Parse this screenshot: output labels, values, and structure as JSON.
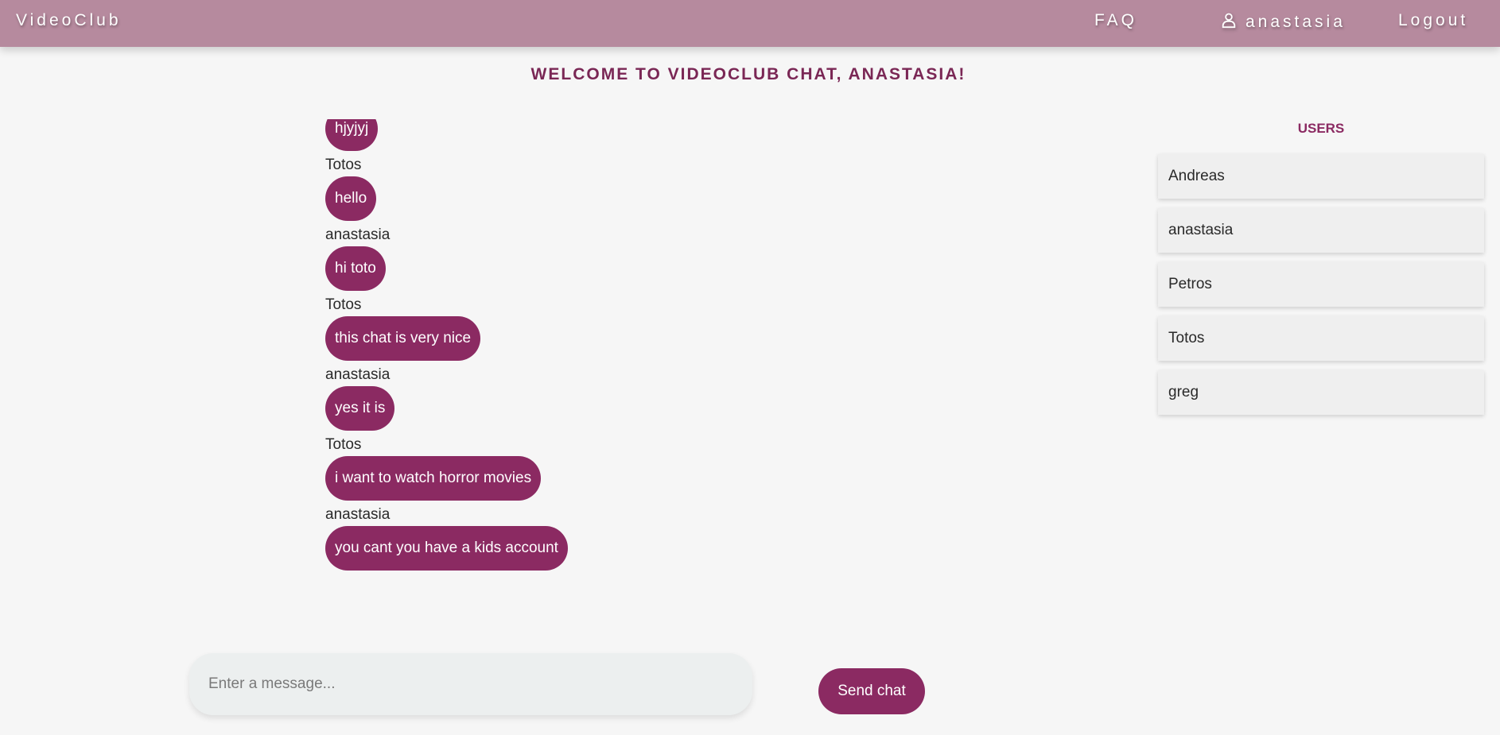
{
  "navbar": {
    "brand": "VideoClub",
    "faq_label": "FAQ",
    "user_label": "anastasia",
    "logout_label": "Logout"
  },
  "welcome": "WELCOME TO VIDEOCLUB CHAT, ANASTASIA!",
  "chat": {
    "messages": [
      {
        "sender": "",
        "text": "hjyjyj"
      },
      {
        "sender": "Totos",
        "text": "hello"
      },
      {
        "sender": "anastasia",
        "text": "hi toto"
      },
      {
        "sender": "Totos",
        "text": "this chat is very nice"
      },
      {
        "sender": "anastasia",
        "text": "yes it is"
      },
      {
        "sender": "Totos",
        "text": "i want to watch horror movies"
      },
      {
        "sender": "anastasia",
        "text": "you cant you have a kids account"
      }
    ]
  },
  "users": {
    "title": "USERS",
    "list": [
      "Andreas",
      "anastasia",
      "Petros",
      "Totos",
      "greg"
    ]
  },
  "composer": {
    "placeholder": "Enter a message...",
    "value": "",
    "send_label": "Send chat"
  },
  "colors": {
    "navbar": "#b68a9e",
    "accent": "#8b2a62",
    "title": "#7a2755",
    "background": "#f6f6f6"
  }
}
